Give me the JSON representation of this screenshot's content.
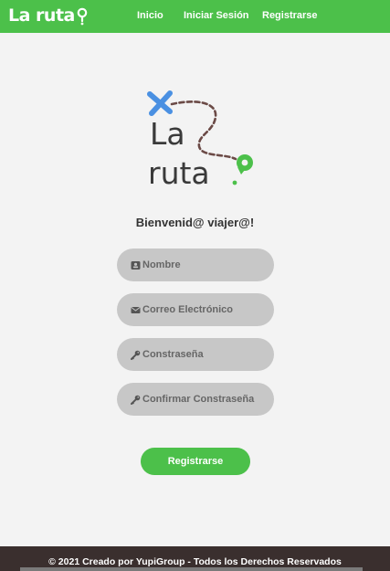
{
  "navbar": {
    "brand": "La ruta",
    "links": [
      "Inicio",
      "Iniciar Sesión",
      "Registrarse"
    ]
  },
  "logo": {
    "line1": "La",
    "line2": "ruta"
  },
  "welcome": "Bienvenid@ viajer@!",
  "form": {
    "fields": [
      {
        "icon": "id-card-icon",
        "placeholder": "Nombre"
      },
      {
        "icon": "envelope-icon",
        "placeholder": "Correo Electrónico"
      },
      {
        "icon": "key-icon",
        "placeholder": "Constraseña"
      },
      {
        "icon": "key-icon",
        "placeholder": "Confirmar Constraseña"
      }
    ],
    "submit": "Registrarse"
  },
  "footer": {
    "text": "© 2021 Creado por YupiGroup - Todos los Derechos Reservados"
  },
  "colors": {
    "brand_green": "#4cc04a",
    "logo_blue": "#4a90e2",
    "footer_bg": "#3a2f2e",
    "field_bg": "#c7c7c7"
  }
}
